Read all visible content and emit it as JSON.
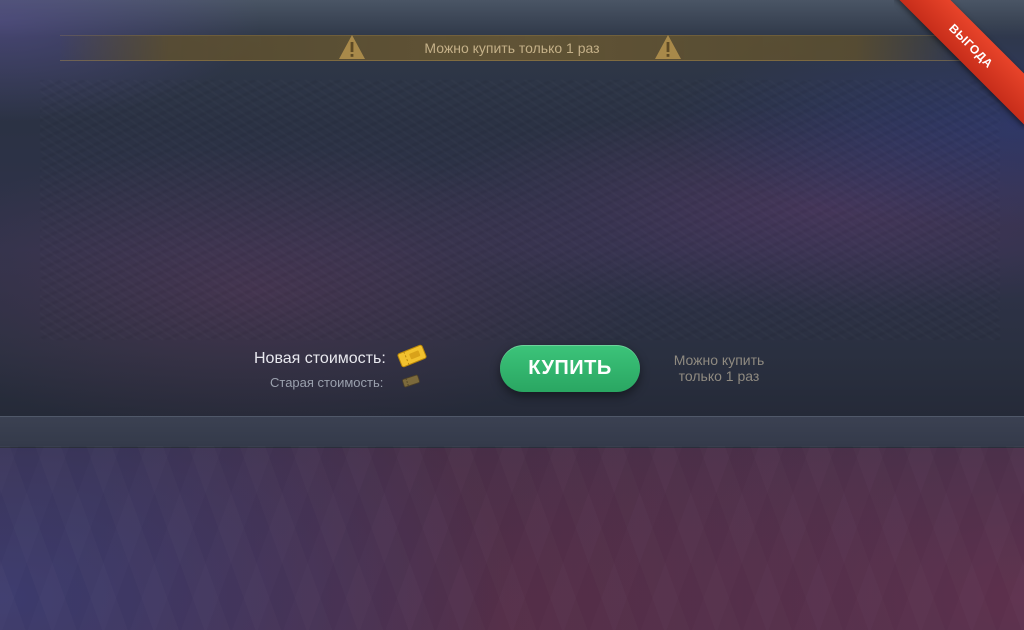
{
  "notice": {
    "text": "Можно купить только 1 раз"
  },
  "ribbon": {
    "label": "ВЫГОДА",
    "color": "#d8381f"
  },
  "pricing": {
    "new_label": "Новая стоимость:",
    "old_label": "Старая стоимость:",
    "currency_icon": "ticket-icon",
    "accent": "#f2c12e"
  },
  "buy": {
    "label": "КУПИТЬ",
    "color": "#2fb56c"
  },
  "side_note": {
    "line1": "Можно купить",
    "line2": "только 1 раз"
  }
}
